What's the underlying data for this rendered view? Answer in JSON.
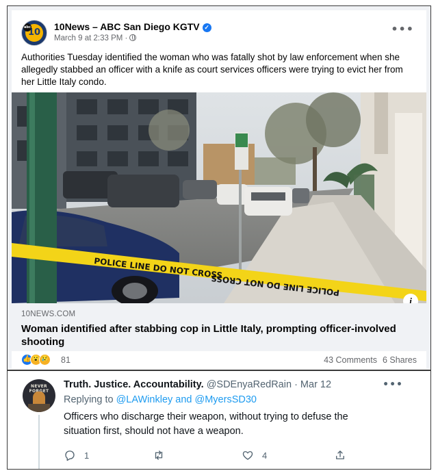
{
  "facebook": {
    "page_name": "10News – ABC San Diego KGTV",
    "avatar_text": "10",
    "date": "March 9 at 2:33 PM ·",
    "post_text": "Authorities Tuesday identified the woman who was fatally shot by law enforcement when she allegedly stabbed an officer with a knife as court services officers were trying to evict her from her Little Italy condo.",
    "tape_text_1": "POLICE LINE DO NOT CROSS",
    "tape_text_2": "POLICE LINE DO NOT CROSS",
    "link_domain": "10NEWS.COM",
    "link_title": "Woman identified after stabbing cop in Little Italy, prompting officer-involved shooting",
    "reaction_count": "81",
    "comments": "43 Comments",
    "shares": "6 Shares",
    "colors": {
      "accent": "#1877f2",
      "secondary_text": "#65676b",
      "link_bg": "#f0f2f5"
    }
  },
  "tweet": {
    "avatar_text": "NEVER FORGET",
    "name": "Truth. Justice. Accountability.",
    "handle": "@SDEnyaRedRain",
    "date": "· Mar 12",
    "replying_prefix": "Replying to",
    "replying_to": "@LAWinkley and @MyersSD30",
    "text": "Officers who discharge their weapon, without trying to defuse the situation first, should not have a weapon.",
    "reply_count": "1",
    "like_count": "4",
    "colors": {
      "link": "#1d9bf0",
      "secondary_text": "#536471"
    }
  }
}
